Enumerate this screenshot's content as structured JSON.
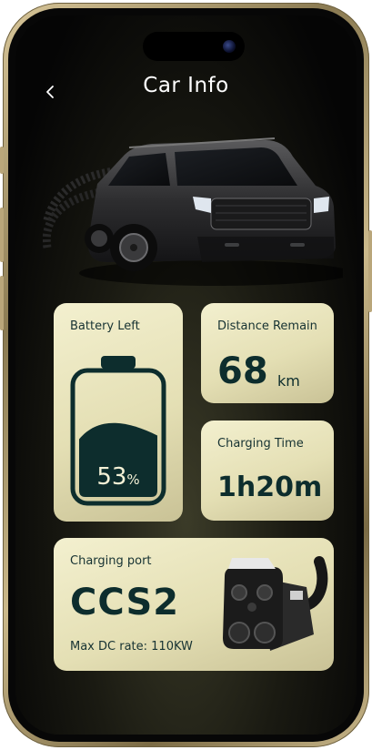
{
  "header": {
    "title": "Car Info",
    "back_icon": "chevron-left-icon"
  },
  "cards": {
    "battery": {
      "label": "Battery Left",
      "value": "53",
      "unit": "%",
      "level": 0.53
    },
    "distance": {
      "label": "Distance Remain",
      "value": "68",
      "unit": "km"
    },
    "charging_time": {
      "label": "Charging Time",
      "value": "1h20m"
    },
    "charging_port": {
      "label": "Charging port",
      "value": "CCS2",
      "rate": "Max DC rate: 110KW"
    }
  },
  "colors": {
    "card_bg": "#ede9c4",
    "dark_text": "#0d2d2d",
    "battery_fill": "#0d2d2d",
    "screen_bg": "#0a0a0a"
  }
}
